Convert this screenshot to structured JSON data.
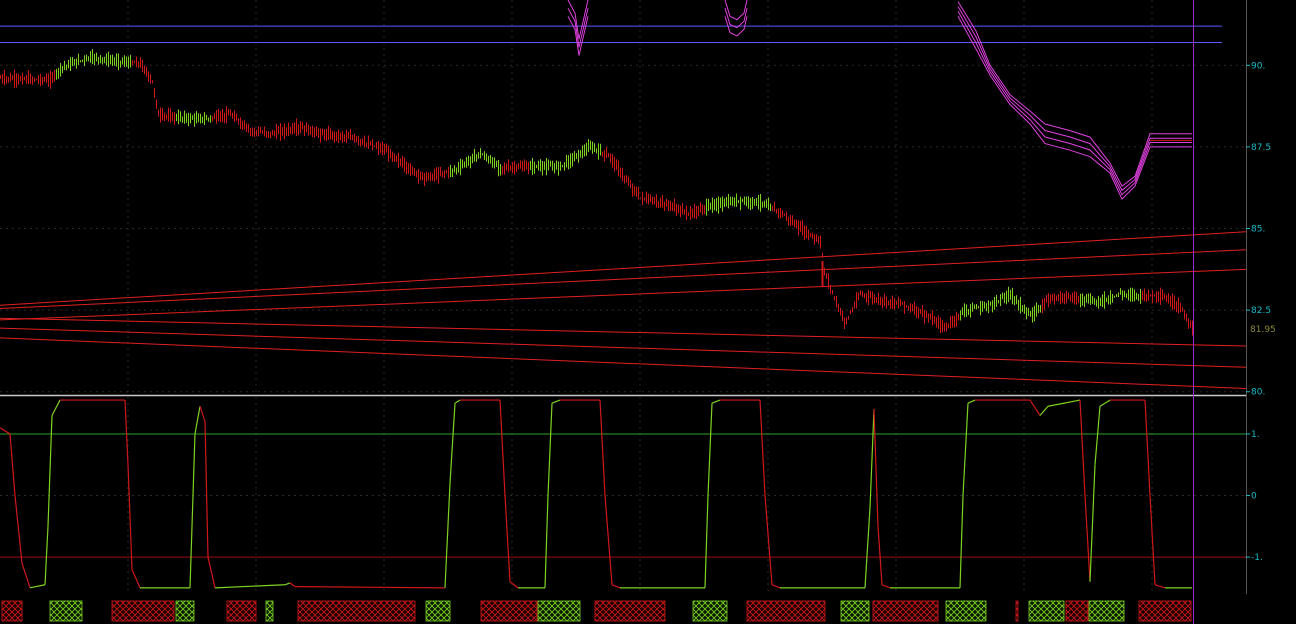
{
  "colors": {
    "background": "#000000",
    "grid": "#2a2a2a",
    "axis_text": "#19b8c8",
    "price_up": "#7ed321",
    "price_down": "#d01818",
    "envelope": "#e040e0",
    "blue_lines": "#5a5aff",
    "trend_lines": "#e02020",
    "cursor": "#9a2ad0",
    "last_price_text": "#8a8a3a",
    "osc_up": "#7ed321",
    "osc_down": "#d01818",
    "level_upper": "#2aa02a",
    "level_lower": "#a01010"
  },
  "chart_data": [
    {
      "type": "candlestick",
      "panel": "price",
      "title": "",
      "y_ticks": [
        "90.",
        "87.5",
        "85.",
        "82.5",
        "80."
      ],
      "ylim": [
        79.9,
        92.0
      ],
      "last_price": "81.95",
      "price_path": [
        [
          0,
          89.6
        ],
        [
          50,
          89.55
        ],
        [
          62,
          89.95
        ],
        [
          90,
          90.25
        ],
        [
          110,
          90.15
        ],
        [
          140,
          90.05
        ],
        [
          152,
          89.5
        ],
        [
          158,
          88.5
        ],
        [
          175,
          88.4
        ],
        [
          205,
          88.35
        ],
        [
          230,
          88.5
        ],
        [
          250,
          88.0
        ],
        [
          270,
          87.9
        ],
        [
          300,
          88.1
        ],
        [
          320,
          87.9
        ],
        [
          350,
          87.8
        ],
        [
          385,
          87.4
        ],
        [
          410,
          86.8
        ],
        [
          425,
          86.55
        ],
        [
          455,
          86.8
        ],
        [
          480,
          87.3
        ],
        [
          500,
          86.85
        ],
        [
          530,
          86.9
        ],
        [
          560,
          86.9
        ],
        [
          590,
          87.5
        ],
        [
          610,
          87.2
        ],
        [
          625,
          86.5
        ],
        [
          640,
          85.95
        ],
        [
          670,
          85.7
        ],
        [
          690,
          85.45
        ],
        [
          710,
          85.7
        ],
        [
          740,
          85.85
        ],
        [
          760,
          85.8
        ],
        [
          780,
          85.5
        ],
        [
          800,
          85.0
        ],
        [
          820,
          84.6
        ],
        [
          824,
          83.7
        ],
        [
          835,
          82.8
        ],
        [
          845,
          82.1
        ],
        [
          860,
          83.0
        ],
        [
          880,
          82.8
        ],
        [
          900,
          82.7
        ],
        [
          920,
          82.45
        ],
        [
          945,
          81.95
        ],
        [
          965,
          82.5
        ],
        [
          990,
          82.65
        ],
        [
          1010,
          83.0
        ],
        [
          1030,
          82.3
        ],
        [
          1050,
          82.9
        ],
        [
          1065,
          82.9
        ],
        [
          1080,
          82.85
        ],
        [
          1100,
          82.75
        ],
        [
          1120,
          83.0
        ],
        [
          1140,
          82.95
        ],
        [
          1160,
          82.95
        ],
        [
          1180,
          82.6
        ],
        [
          1192,
          81.95
        ]
      ],
      "trend_lines": [
        [
          [
            0,
            82.65
          ],
          [
            1246,
            84.9
          ]
        ],
        [
          [
            0,
            82.55
          ],
          [
            1246,
            84.35
          ]
        ],
        [
          [
            0,
            82.2
          ],
          [
            1246,
            83.75
          ]
        ],
        [
          [
            0,
            82.25
          ],
          [
            1246,
            81.4
          ]
        ],
        [
          [
            0,
            81.95
          ],
          [
            1246,
            80.75
          ]
        ],
        [
          [
            0,
            81.65
          ],
          [
            1246,
            80.1
          ]
        ]
      ],
      "horizontal_lines": [
        91.2,
        90.7
      ],
      "envelope_upper": [
        [
          958,
          91.95
        ],
        [
          976,
          91.05
        ],
        [
          990,
          90.0
        ],
        [
          1010,
          89.1
        ],
        [
          1030,
          88.6
        ],
        [
          1045,
          88.2
        ],
        [
          1070,
          88.0
        ],
        [
          1090,
          87.8
        ],
        [
          1110,
          87.0
        ],
        [
          1122,
          86.3
        ],
        [
          1135,
          86.6
        ],
        [
          1150,
          87.9
        ],
        [
          1192,
          87.9
        ]
      ],
      "envelope_lower": [
        [
          958,
          91.5
        ],
        [
          976,
          90.5
        ],
        [
          990,
          89.7
        ],
        [
          1010,
          88.8
        ],
        [
          1030,
          88.2
        ],
        [
          1045,
          87.6
        ],
        [
          1070,
          87.4
        ],
        [
          1090,
          87.2
        ],
        [
          1110,
          86.7
        ],
        [
          1122,
          85.9
        ],
        [
          1135,
          86.3
        ],
        [
          1150,
          87.5
        ],
        [
          1192,
          87.5
        ]
      ],
      "envelope_top_left": [
        [
          568,
          92.0
        ],
        [
          575,
          91.6
        ],
        [
          579,
          90.8
        ],
        [
          585,
          91.6
        ],
        [
          588,
          92.0
        ]
      ],
      "envelope_top_mid": [
        [
          725,
          92.0
        ],
        [
          730,
          91.5
        ],
        [
          737,
          91.4
        ],
        [
          744,
          91.6
        ],
        [
          747,
          92.0
        ]
      ]
    },
    {
      "type": "line",
      "panel": "oscillator",
      "title": "",
      "y_ticks": [
        "1.",
        "0",
        "-1."
      ],
      "ylim": [
        -1.6,
        1.6
      ],
      "levels": [
        1,
        -1
      ],
      "series": [
        {
          "values": [
            [
              0,
              1.1
            ],
            [
              10,
              1.0
            ],
            [
              15,
              0.0
            ],
            [
              22,
              -1.1
            ],
            [
              30,
              -1.5
            ],
            [
              45,
              -1.45
            ],
            [
              48,
              -0.5
            ],
            [
              52,
              1.3
            ],
            [
              60,
              1.55
            ],
            [
              90,
              1.55
            ],
            [
              125,
              1.55
            ],
            [
              128,
              0.5
            ],
            [
              132,
              -1.2
            ],
            [
              140,
              -1.5
            ],
            [
              190,
              -1.5
            ],
            [
              195,
              1.0
            ],
            [
              200,
              1.45
            ],
            [
              205,
              1.2
            ],
            [
              208,
              -1.0
            ],
            [
              215,
              -1.5
            ],
            [
              285,
              -1.45
            ],
            [
              290,
              -1.42
            ],
            [
              295,
              -1.48
            ],
            [
              445,
              -1.5
            ],
            [
              450,
              0.2
            ],
            [
              455,
              1.5
            ],
            [
              460,
              1.55
            ],
            [
              500,
              1.55
            ],
            [
              505,
              0.0
            ],
            [
              510,
              -1.4
            ],
            [
              518,
              -1.5
            ],
            [
              545,
              -1.5
            ],
            [
              548,
              0.0
            ],
            [
              552,
              1.5
            ],
            [
              560,
              1.55
            ],
            [
              600,
              1.55
            ],
            [
              605,
              0.0
            ],
            [
              612,
              -1.45
            ],
            [
              620,
              -1.5
            ],
            [
              705,
              -1.5
            ],
            [
              708,
              0.0
            ],
            [
              712,
              1.5
            ],
            [
              720,
              1.55
            ],
            [
              760,
              1.55
            ],
            [
              765,
              0.0
            ],
            [
              772,
              -1.45
            ],
            [
              780,
              -1.5
            ],
            [
              865,
              -1.5
            ],
            [
              870,
              -0.2
            ],
            [
              874,
              1.4
            ],
            [
              878,
              -0.5
            ],
            [
              882,
              -1.45
            ],
            [
              890,
              -1.5
            ],
            [
              960,
              -1.5
            ],
            [
              963,
              0.0
            ],
            [
              968,
              1.5
            ],
            [
              975,
              1.55
            ],
            [
              1030,
              1.55
            ],
            [
              1040,
              1.3
            ],
            [
              1048,
              1.45
            ],
            [
              1080,
              1.55
            ],
            [
              1085,
              0.0
            ],
            [
              1090,
              -1.4
            ],
            [
              1095,
              0.5
            ],
            [
              1100,
              1.45
            ],
            [
              1110,
              1.55
            ],
            [
              1145,
              1.55
            ],
            [
              1150,
              0.0
            ],
            [
              1155,
              -1.45
            ],
            [
              1165,
              -1.5
            ],
            [
              1192,
              -1.5
            ]
          ]
        }
      ]
    },
    {
      "type": "segments",
      "panel": "state_bar",
      "title": "",
      "segments": [
        [
          2,
          22,
          "down"
        ],
        [
          50,
          82,
          "up"
        ],
        [
          112,
          174,
          "down"
        ],
        [
          176,
          194,
          "up"
        ],
        [
          227,
          256,
          "down"
        ],
        [
          266,
          273,
          "up"
        ],
        [
          298,
          415,
          "down"
        ],
        [
          426,
          450,
          "up"
        ],
        [
          481,
          537,
          "down"
        ],
        [
          538,
          580,
          "up"
        ],
        [
          595,
          665,
          "down"
        ],
        [
          693,
          727,
          "up"
        ],
        [
          747,
          825,
          "down"
        ],
        [
          841,
          869,
          "up"
        ],
        [
          873,
          938,
          "down"
        ],
        [
          946,
          986,
          "up"
        ],
        [
          1016,
          1018,
          "down"
        ],
        [
          1029,
          1064,
          "up"
        ],
        [
          1066,
          1088,
          "down"
        ],
        [
          1089,
          1124,
          "up"
        ],
        [
          1139,
          1191,
          "down"
        ]
      ]
    }
  ]
}
